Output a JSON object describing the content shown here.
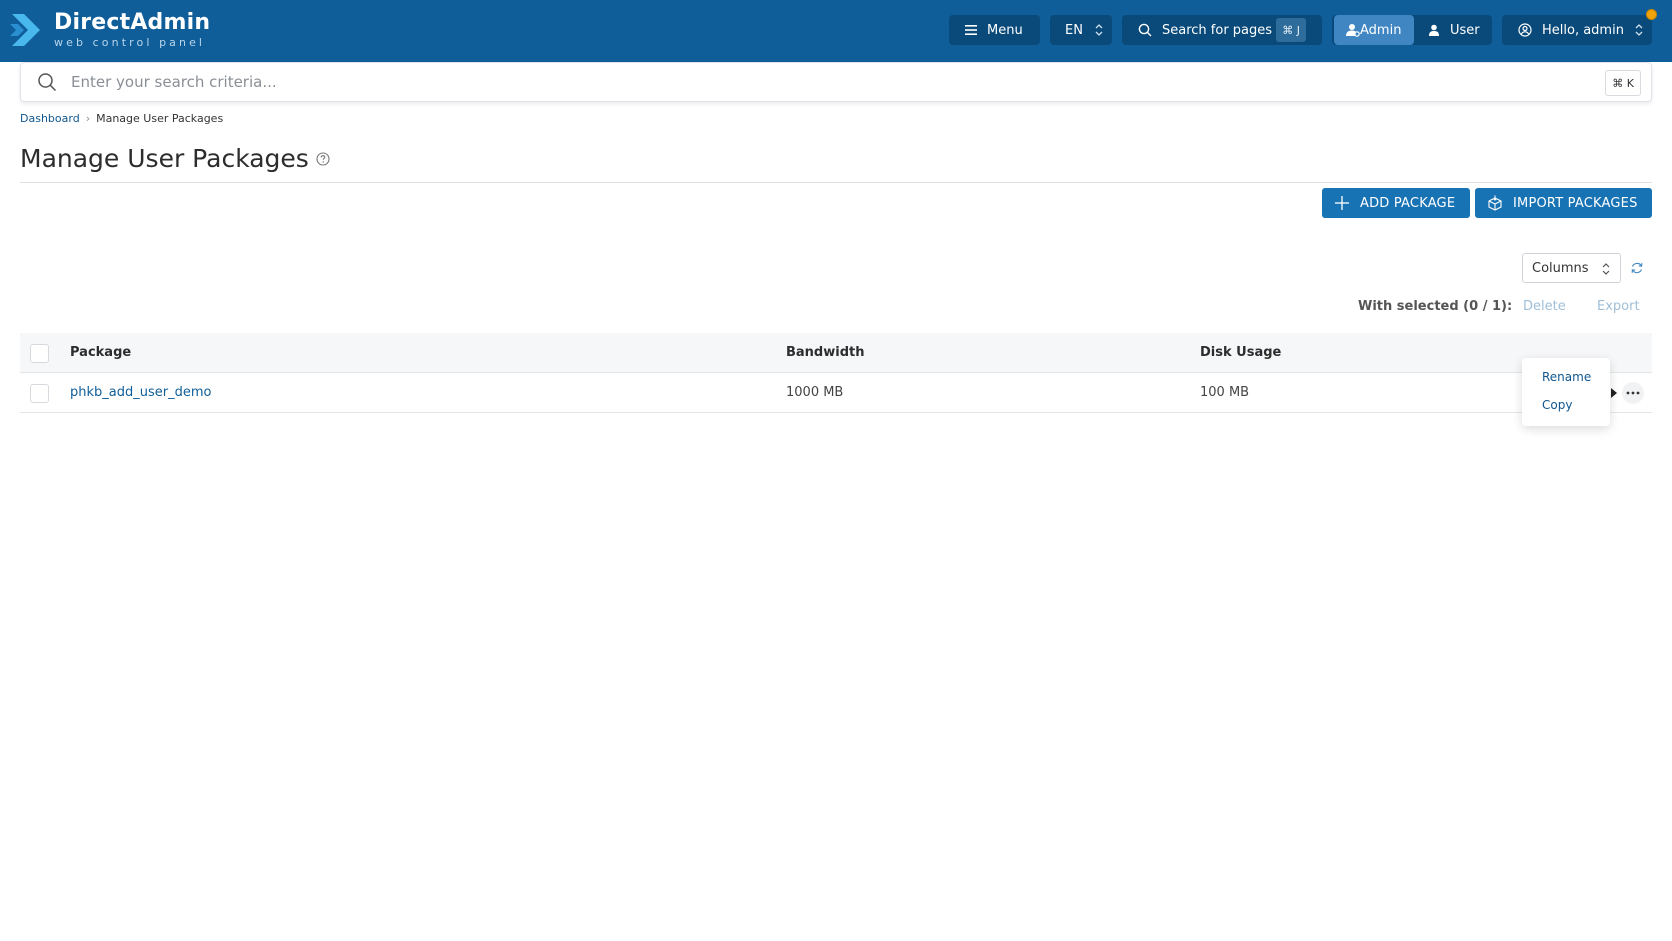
{
  "header": {
    "brand_name": "DirectAdmin",
    "brand_sub": "web control panel",
    "menu_label": "Menu",
    "language": "EN",
    "search_pages_label": "Search for pages",
    "search_pages_shortcut": "⌘ J",
    "mode_admin": "Admin",
    "mode_user": "User",
    "greeting": "Hello, admin"
  },
  "search": {
    "placeholder": "Enter your search criteria...",
    "shortcut": "⌘ K"
  },
  "breadcrumb": {
    "items": [
      "Dashboard",
      "Manage User Packages"
    ]
  },
  "page": {
    "title": "Manage User Packages"
  },
  "actions": {
    "add_package": "ADD PACKAGE",
    "import_packages": "IMPORT PACKAGES"
  },
  "table_controls": {
    "columns_label": "Columns",
    "with_selected": "With selected (0 / 1):",
    "delete": "Delete",
    "export": "Export"
  },
  "table": {
    "columns": [
      "Package",
      "Bandwidth",
      "Disk Usage"
    ],
    "rows": [
      {
        "package": "phkb_add_user_demo",
        "bandwidth": "1000 MB",
        "disk_usage": "100 MB"
      }
    ]
  },
  "row_menu": {
    "items": [
      "Rename",
      "Copy"
    ]
  },
  "colors": {
    "topbar": "#0f5e99",
    "primary_button": "#1873b4",
    "link": "#0f5e99",
    "notification_dot": "#f0a30a"
  }
}
